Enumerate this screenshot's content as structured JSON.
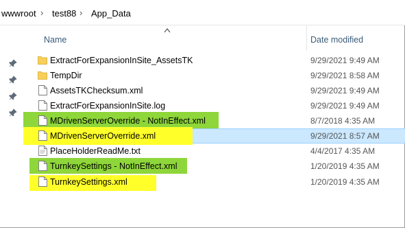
{
  "breadcrumb": {
    "items": [
      "wwwroot",
      "test88",
      "App_Data"
    ],
    "separator": "›"
  },
  "columns": {
    "name": "Name",
    "date_modified": "Date modified",
    "sort_indicator": "ascending"
  },
  "files": [
    {
      "name": "ExtractForExpansionInSite_AssetsTK",
      "date": "9/29/2021 9:49 AM",
      "type": "folder",
      "highlight": "none"
    },
    {
      "name": "TempDir",
      "date": "9/29/2021 8:58 AM",
      "type": "folder",
      "highlight": "none"
    },
    {
      "name": "AssetsTKChecksum.xml",
      "date": "9/29/2021 9:49 AM",
      "type": "file",
      "highlight": "none"
    },
    {
      "name": "ExtractForExpansionInSite.log",
      "date": "9/29/2021 9:49 AM",
      "type": "file",
      "highlight": "none"
    },
    {
      "name": "MDrivenServerOverride - NotInEffect.xml",
      "date": "8/7/2018 4:35 AM",
      "type": "file",
      "highlight": "green"
    },
    {
      "name": "MDrivenServerOverride.xml",
      "date": "9/29/2021 8:57 AM",
      "type": "file",
      "highlight": "yellow-selected"
    },
    {
      "name": "PlaceHolderReadMe.txt",
      "date": "4/4/2017 4:35 AM",
      "type": "file",
      "highlight": "none"
    },
    {
      "name": "TurnkeySettings - NotInEffect.xml",
      "date": "1/20/2019 4:35 AM",
      "type": "file",
      "highlight": "green"
    },
    {
      "name": "TurnkeySettings.xml",
      "date": "1/20/2019 4:35 AM",
      "type": "file",
      "highlight": "yellow"
    }
  ],
  "colors": {
    "folder": "#f7cf5a",
    "highlight_green": "#8ed63a",
    "highlight_yellow": "#ffff2a",
    "selection": "#cce8ff",
    "selection_border": "#99d1ff",
    "header_text": "#3a5b7a"
  },
  "nav_pins": [
    "pin-icon",
    "pin-icon",
    "pin-icon",
    "pin-icon"
  ]
}
